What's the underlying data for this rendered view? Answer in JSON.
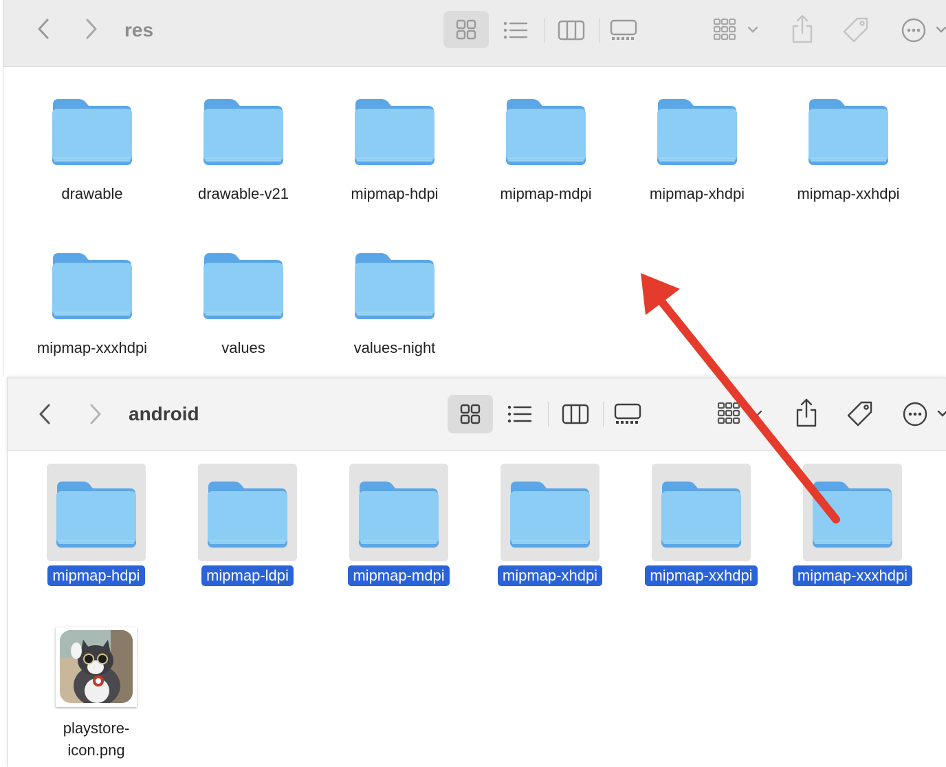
{
  "top_window": {
    "title": "res",
    "items": [
      {
        "label": "drawable"
      },
      {
        "label": "drawable-v21"
      },
      {
        "label": "mipmap-hdpi"
      },
      {
        "label": "mipmap-mdpi"
      },
      {
        "label": "mipmap-xhdpi"
      },
      {
        "label": "mipmap-xxhdpi"
      },
      {
        "label": "mipmap-xxxhdpi"
      },
      {
        "label": "values"
      },
      {
        "label": "values-night"
      }
    ]
  },
  "bottom_window": {
    "title": "android",
    "items": [
      {
        "label": "mipmap-hdpi",
        "selected": true
      },
      {
        "label": "mipmap-ldpi",
        "selected": true
      },
      {
        "label": "mipmap-mdpi",
        "selected": true
      },
      {
        "label": "mipmap-xhdpi",
        "selected": true
      },
      {
        "label": "mipmap-xxhdpi",
        "selected": true
      },
      {
        "label": "mipmap-xxxhdpi",
        "selected": true
      }
    ],
    "file": {
      "label_line1": "playstore-",
      "label_line2": "icon.png"
    }
  },
  "colors": {
    "folder_body": "#8ccdf5",
    "folder_tab": "#5ba6e6",
    "selection": "#2a62d8",
    "arrow": "#e53b2c"
  }
}
